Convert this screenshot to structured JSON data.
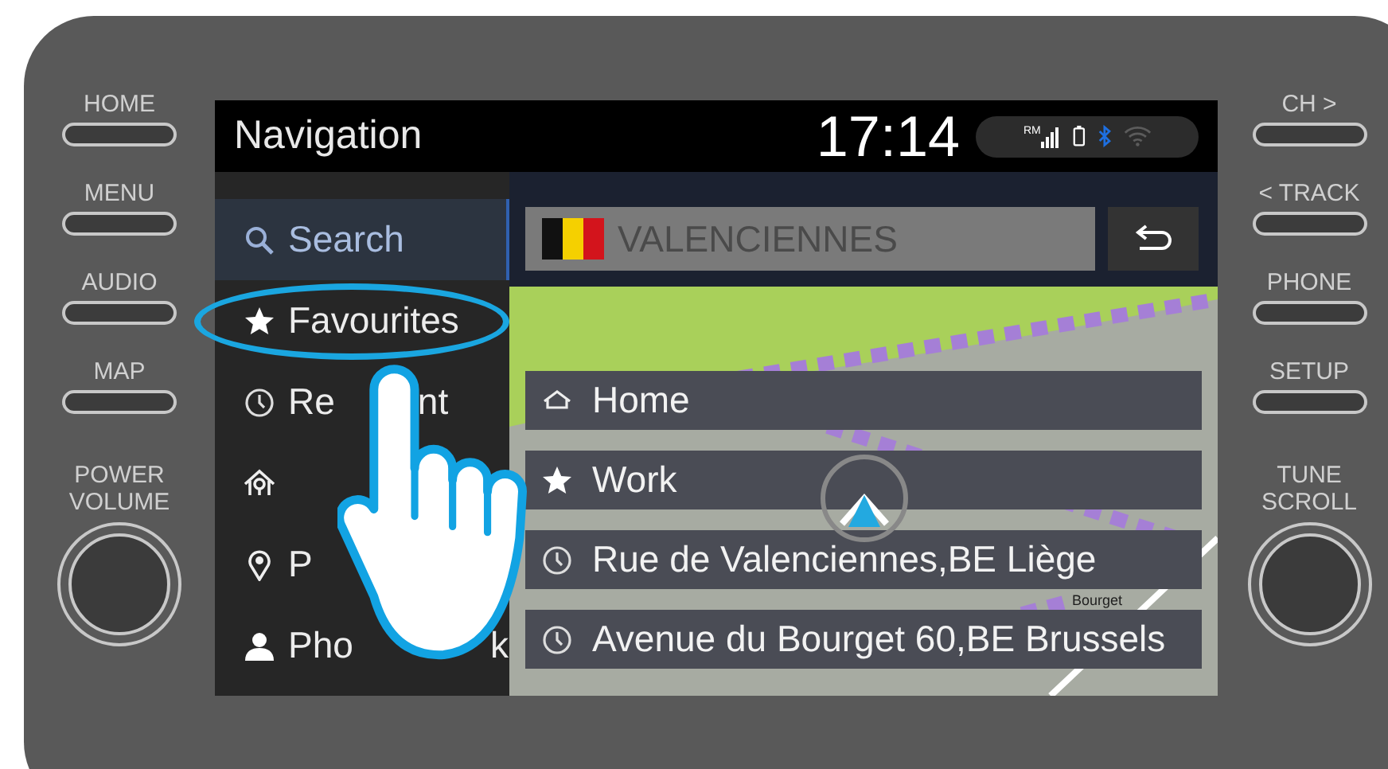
{
  "left_buttons": [
    {
      "label": "HOME"
    },
    {
      "label": "MENU"
    },
    {
      "label": "AUDIO"
    },
    {
      "label": "MAP"
    }
  ],
  "left_knob": {
    "label_lines": [
      "POWER",
      "VOLUME"
    ]
  },
  "right_buttons": [
    {
      "label": "CH >"
    },
    {
      "label": "< TRACK"
    },
    {
      "label": "PHONE"
    },
    {
      "label": "SETUP"
    }
  ],
  "right_knob": {
    "label_lines": [
      "TUNE",
      "SCROLL"
    ]
  },
  "header": {
    "title": "Navigation",
    "time": "17:14",
    "signal_label": "RM",
    "bluetooth_on": true,
    "wifi_on": false
  },
  "sidebar": {
    "items": [
      {
        "label_parts": [
          "Search"
        ],
        "selected": true,
        "circled": false
      },
      {
        "label_parts": [
          "Favourites"
        ],
        "selected": false,
        "circled": true
      },
      {
        "label_parts": [
          "Re",
          "nt"
        ],
        "selected": false,
        "circled": false
      },
      {
        "selected": false,
        "circled": false
      },
      {
        "label_parts": [
          "P"
        ],
        "selected": false,
        "circled": false
      },
      {
        "label_parts": [
          "Pho",
          "k"
        ],
        "selected": false,
        "circled": false
      }
    ]
  },
  "search_field": {
    "placeholder": "VALENCIENNES"
  },
  "map": {
    "street_label": "Bourget"
  },
  "favourites": [
    {
      "kind": "home",
      "label": "Home"
    },
    {
      "kind": "work",
      "label": "Work"
    },
    {
      "kind": "recent",
      "label": "Rue de Valenciennes,BE Liège"
    },
    {
      "kind": "recent",
      "label": "Avenue du Bourget 60,BE Brussels"
    }
  ]
}
